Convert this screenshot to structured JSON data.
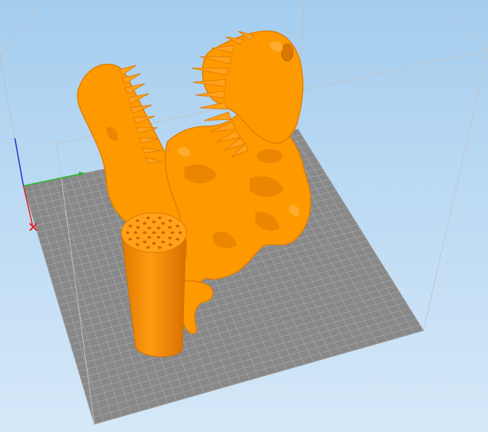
{
  "viewport": {
    "view": "3d-perspective",
    "background_top": "#a4cdee",
    "background_bottom": "#d4e8f8",
    "build_plate_color": "#888888",
    "grid_line_color": "#a9a9a9",
    "build_volume_line_color": "#bfbfbf"
  },
  "model": {
    "color": "#ff9900",
    "shadow_color": "#d97800",
    "highlight_color": "#ffb84d"
  },
  "axes": {
    "x_color": "#e02020",
    "y_color": "#22bb22",
    "z_color": "#2233cc",
    "x_marker_icon": "x-mark-icon"
  }
}
